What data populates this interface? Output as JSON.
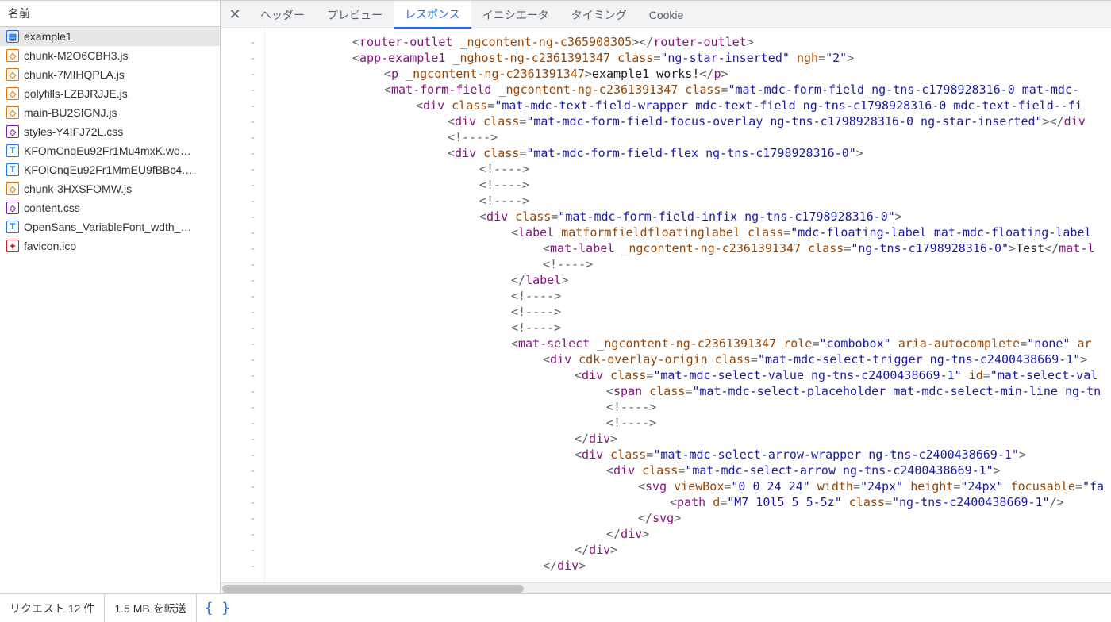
{
  "sidebar": {
    "header": "名前",
    "files": [
      {
        "name": "example1",
        "iconClass": "icon-doc",
        "glyph": "▤",
        "selected": true
      },
      {
        "name": "chunk-M2O6CBH3.js",
        "iconClass": "icon-js",
        "glyph": "◇"
      },
      {
        "name": "chunk-7MIHQPLA.js",
        "iconClass": "icon-js",
        "glyph": "◇"
      },
      {
        "name": "polyfills-LZBJRJJE.js",
        "iconClass": "icon-js",
        "glyph": "◇"
      },
      {
        "name": "main-BU2SIGNJ.js",
        "iconClass": "icon-js",
        "glyph": "◇"
      },
      {
        "name": "styles-Y4IFJ72L.css",
        "iconClass": "icon-css",
        "glyph": "◇"
      },
      {
        "name": "KFOmCnqEu92Fr1Mu4mxK.wo…",
        "iconClass": "icon-font",
        "glyph": "T"
      },
      {
        "name": "KFOlCnqEu92Fr1MmEU9fBBc4.…",
        "iconClass": "icon-font",
        "glyph": "T"
      },
      {
        "name": "chunk-3HXSFOMW.js",
        "iconClass": "icon-js",
        "glyph": "◇"
      },
      {
        "name": "content.css",
        "iconClass": "icon-css",
        "glyph": "◇"
      },
      {
        "name": "OpenSans_VariableFont_wdth_…",
        "iconClass": "icon-font",
        "glyph": "T"
      },
      {
        "name": "favicon.ico",
        "iconClass": "icon-ico",
        "glyph": "✦"
      }
    ]
  },
  "tabs": [
    {
      "label": "ヘッダー",
      "active": false
    },
    {
      "label": "プレビュー",
      "active": false
    },
    {
      "label": "レスポンス",
      "active": true
    },
    {
      "label": "イニシエータ",
      "active": false
    },
    {
      "label": "タイミング",
      "active": false
    },
    {
      "label": "Cookie",
      "active": false
    }
  ],
  "gutterMark": "-",
  "code": [
    {
      "indent": 110,
      "tokens": [
        [
          "b",
          "<"
        ],
        [
          "t",
          "router-outlet"
        ],
        [
          "b",
          " "
        ],
        [
          "a",
          "_ngcontent-ng-c365908305"
        ],
        [
          "b",
          ">"
        ],
        [
          "b",
          "</"
        ],
        [
          "t",
          "router-outlet"
        ],
        [
          "b",
          ">"
        ]
      ]
    },
    {
      "indent": 110,
      "tokens": [
        [
          "b",
          "<"
        ],
        [
          "t",
          "app-example1"
        ],
        [
          "b",
          " "
        ],
        [
          "a",
          "_nghost-ng-c2361391347"
        ],
        [
          "b",
          " "
        ],
        [
          "a",
          "class"
        ],
        [
          "b",
          "="
        ],
        [
          "v",
          "\"ng-star-inserted\""
        ],
        [
          "b",
          " "
        ],
        [
          "a",
          "ngh"
        ],
        [
          "b",
          "="
        ],
        [
          "v",
          "\"2\""
        ],
        [
          "b",
          ">"
        ]
      ]
    },
    {
      "indent": 150,
      "tokens": [
        [
          "b",
          "<"
        ],
        [
          "t",
          "p"
        ],
        [
          "b",
          " "
        ],
        [
          "a",
          "_ngcontent-ng-c2361391347"
        ],
        [
          "b",
          ">"
        ],
        [
          "tx",
          "example1 works!"
        ],
        [
          "b",
          "</"
        ],
        [
          "t",
          "p"
        ],
        [
          "b",
          ">"
        ]
      ]
    },
    {
      "indent": 150,
      "tokens": [
        [
          "b",
          "<"
        ],
        [
          "t",
          "mat-form-field"
        ],
        [
          "b",
          " "
        ],
        [
          "a",
          "_ngcontent-ng-c2361391347"
        ],
        [
          "b",
          " "
        ],
        [
          "a",
          "class"
        ],
        [
          "b",
          "="
        ],
        [
          "v",
          "\"mat-mdc-form-field ng-tns-c1798928316-0 mat-mdc-"
        ]
      ]
    },
    {
      "indent": 190,
      "tokens": [
        [
          "b",
          "<"
        ],
        [
          "t",
          "div"
        ],
        [
          "b",
          " "
        ],
        [
          "a",
          "class"
        ],
        [
          "b",
          "="
        ],
        [
          "v",
          "\"mat-mdc-text-field-wrapper mdc-text-field ng-tns-c1798928316-0 mdc-text-field--fi"
        ]
      ]
    },
    {
      "indent": 230,
      "tokens": [
        [
          "b",
          "<"
        ],
        [
          "t",
          "div"
        ],
        [
          "b",
          " "
        ],
        [
          "a",
          "class"
        ],
        [
          "b",
          "="
        ],
        [
          "v",
          "\"mat-mdc-form-field-focus-overlay ng-tns-c1798928316-0 ng-star-inserted\""
        ],
        [
          "b",
          ">"
        ],
        [
          "b",
          "</"
        ],
        [
          "t",
          "div"
        ]
      ]
    },
    {
      "indent": 230,
      "tokens": [
        [
          "cm",
          "<!---->"
        ]
      ]
    },
    {
      "indent": 230,
      "tokens": [
        [
          "b",
          "<"
        ],
        [
          "t",
          "div"
        ],
        [
          "b",
          " "
        ],
        [
          "a",
          "class"
        ],
        [
          "b",
          "="
        ],
        [
          "v",
          "\"mat-mdc-form-field-flex ng-tns-c1798928316-0\""
        ],
        [
          "b",
          ">"
        ]
      ]
    },
    {
      "indent": 270,
      "tokens": [
        [
          "cm",
          "<!---->"
        ]
      ]
    },
    {
      "indent": 270,
      "tokens": [
        [
          "cm",
          "<!---->"
        ]
      ]
    },
    {
      "indent": 270,
      "tokens": [
        [
          "cm",
          "<!---->"
        ]
      ]
    },
    {
      "indent": 270,
      "tokens": [
        [
          "b",
          "<"
        ],
        [
          "t",
          "div"
        ],
        [
          "b",
          " "
        ],
        [
          "a",
          "class"
        ],
        [
          "b",
          "="
        ],
        [
          "v",
          "\"mat-mdc-form-field-infix ng-tns-c1798928316-0\""
        ],
        [
          "b",
          ">"
        ]
      ]
    },
    {
      "indent": 310,
      "tokens": [
        [
          "b",
          "<"
        ],
        [
          "t",
          "label"
        ],
        [
          "b",
          " "
        ],
        [
          "a",
          "matformfieldfloatinglabel"
        ],
        [
          "b",
          " "
        ],
        [
          "a",
          "class"
        ],
        [
          "b",
          "="
        ],
        [
          "v",
          "\"mdc-floating-label mat-mdc-floating-label"
        ]
      ]
    },
    {
      "indent": 350,
      "tokens": [
        [
          "b",
          "<"
        ],
        [
          "t",
          "mat-label"
        ],
        [
          "b",
          " "
        ],
        [
          "a",
          "_ngcontent-ng-c2361391347"
        ],
        [
          "b",
          " "
        ],
        [
          "a",
          "class"
        ],
        [
          "b",
          "="
        ],
        [
          "v",
          "\"ng-tns-c1798928316-0\""
        ],
        [
          "b",
          ">"
        ],
        [
          "tx",
          "Test"
        ],
        [
          "b",
          "</"
        ],
        [
          "t",
          "mat-l"
        ]
      ]
    },
    {
      "indent": 350,
      "tokens": [
        [
          "cm",
          "<!---->"
        ]
      ]
    },
    {
      "indent": 310,
      "tokens": [
        [
          "b",
          "</"
        ],
        [
          "t",
          "label"
        ],
        [
          "b",
          ">"
        ]
      ]
    },
    {
      "indent": 310,
      "tokens": [
        [
          "cm",
          "<!---->"
        ]
      ]
    },
    {
      "indent": 310,
      "tokens": [
        [
          "cm",
          "<!---->"
        ]
      ]
    },
    {
      "indent": 310,
      "tokens": [
        [
          "cm",
          "<!---->"
        ]
      ]
    },
    {
      "indent": 310,
      "tokens": [
        [
          "b",
          "<"
        ],
        [
          "t",
          "mat-select"
        ],
        [
          "b",
          " "
        ],
        [
          "a",
          "_ngcontent-ng-c2361391347"
        ],
        [
          "b",
          " "
        ],
        [
          "a",
          "role"
        ],
        [
          "b",
          "="
        ],
        [
          "v",
          "\"combobox\""
        ],
        [
          "b",
          " "
        ],
        [
          "a",
          "aria-autocomplete"
        ],
        [
          "b",
          "="
        ],
        [
          "v",
          "\"none\""
        ],
        [
          "b",
          " "
        ],
        [
          "a",
          "ar"
        ]
      ]
    },
    {
      "indent": 350,
      "tokens": [
        [
          "b",
          "<"
        ],
        [
          "t",
          "div"
        ],
        [
          "b",
          " "
        ],
        [
          "a",
          "cdk-overlay-origin"
        ],
        [
          "b",
          " "
        ],
        [
          "a",
          "class"
        ],
        [
          "b",
          "="
        ],
        [
          "v",
          "\"mat-mdc-select-trigger ng-tns-c2400438669-1\""
        ],
        [
          "b",
          ">"
        ]
      ]
    },
    {
      "indent": 390,
      "tokens": [
        [
          "b",
          "<"
        ],
        [
          "t",
          "div"
        ],
        [
          "b",
          " "
        ],
        [
          "a",
          "class"
        ],
        [
          "b",
          "="
        ],
        [
          "v",
          "\"mat-mdc-select-value ng-tns-c2400438669-1\""
        ],
        [
          "b",
          " "
        ],
        [
          "a",
          "id"
        ],
        [
          "b",
          "="
        ],
        [
          "v",
          "\"mat-select-val"
        ]
      ]
    },
    {
      "indent": 430,
      "tokens": [
        [
          "b",
          "<"
        ],
        [
          "t",
          "span"
        ],
        [
          "b",
          " "
        ],
        [
          "a",
          "class"
        ],
        [
          "b",
          "="
        ],
        [
          "v",
          "\"mat-mdc-select-placeholder mat-mdc-select-min-line ng-tn"
        ]
      ]
    },
    {
      "indent": 430,
      "tokens": [
        [
          "cm",
          "<!---->"
        ]
      ]
    },
    {
      "indent": 430,
      "tokens": [
        [
          "cm",
          "<!---->"
        ]
      ]
    },
    {
      "indent": 390,
      "tokens": [
        [
          "b",
          "</"
        ],
        [
          "t",
          "div"
        ],
        [
          "b",
          ">"
        ]
      ]
    },
    {
      "indent": 390,
      "tokens": [
        [
          "b",
          "<"
        ],
        [
          "t",
          "div"
        ],
        [
          "b",
          " "
        ],
        [
          "a",
          "class"
        ],
        [
          "b",
          "="
        ],
        [
          "v",
          "\"mat-mdc-select-arrow-wrapper ng-tns-c2400438669-1\""
        ],
        [
          "b",
          ">"
        ]
      ]
    },
    {
      "indent": 430,
      "tokens": [
        [
          "b",
          "<"
        ],
        [
          "t",
          "div"
        ],
        [
          "b",
          " "
        ],
        [
          "a",
          "class"
        ],
        [
          "b",
          "="
        ],
        [
          "v",
          "\"mat-mdc-select-arrow ng-tns-c2400438669-1\""
        ],
        [
          "b",
          ">"
        ]
      ]
    },
    {
      "indent": 470,
      "tokens": [
        [
          "b",
          "<"
        ],
        [
          "t",
          "svg"
        ],
        [
          "b",
          " "
        ],
        [
          "a",
          "viewBox"
        ],
        [
          "b",
          "="
        ],
        [
          "v",
          "\"0 0 24 24\""
        ],
        [
          "b",
          " "
        ],
        [
          "a",
          "width"
        ],
        [
          "b",
          "="
        ],
        [
          "v",
          "\"24px\""
        ],
        [
          "b",
          " "
        ],
        [
          "a",
          "height"
        ],
        [
          "b",
          "="
        ],
        [
          "v",
          "\"24px\""
        ],
        [
          "b",
          " "
        ],
        [
          "a",
          "focusable"
        ],
        [
          "b",
          "="
        ],
        [
          "v",
          "\"fa"
        ]
      ]
    },
    {
      "indent": 510,
      "tokens": [
        [
          "b",
          "<"
        ],
        [
          "t",
          "path"
        ],
        [
          "b",
          " "
        ],
        [
          "a",
          "d"
        ],
        [
          "b",
          "="
        ],
        [
          "v",
          "\"M7 10l5 5 5-5z\""
        ],
        [
          "b",
          " "
        ],
        [
          "a",
          "class"
        ],
        [
          "b",
          "="
        ],
        [
          "v",
          "\"ng-tns-c2400438669-1\""
        ],
        [
          "b",
          "/>"
        ]
      ]
    },
    {
      "indent": 470,
      "tokens": [
        [
          "b",
          "</"
        ],
        [
          "t",
          "svg"
        ],
        [
          "b",
          ">"
        ]
      ]
    },
    {
      "indent": 430,
      "tokens": [
        [
          "b",
          "</"
        ],
        [
          "t",
          "div"
        ],
        [
          "b",
          ">"
        ]
      ]
    },
    {
      "indent": 390,
      "tokens": [
        [
          "b",
          "</"
        ],
        [
          "t",
          "div"
        ],
        [
          "b",
          ">"
        ]
      ]
    },
    {
      "indent": 350,
      "tokens": [
        [
          "b",
          "</"
        ],
        [
          "t",
          "div"
        ],
        [
          "b",
          ">"
        ]
      ]
    }
  ],
  "status": {
    "requests": "リクエスト 12 件",
    "transfer": "1.5 MB を転送"
  }
}
